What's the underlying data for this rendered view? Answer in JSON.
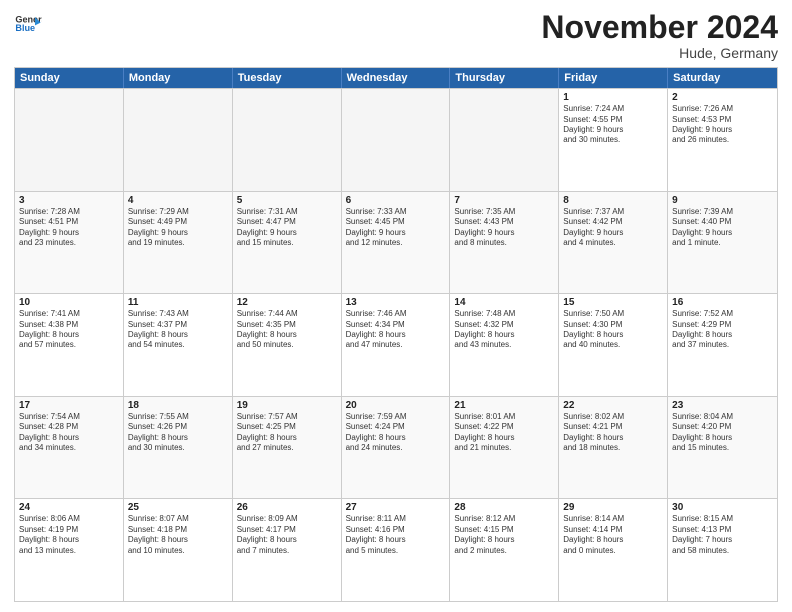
{
  "logo": {
    "general": "General",
    "blue": "Blue"
  },
  "header": {
    "month": "November 2024",
    "location": "Hude, Germany"
  },
  "weekdays": [
    "Sunday",
    "Monday",
    "Tuesday",
    "Wednesday",
    "Thursday",
    "Friday",
    "Saturday"
  ],
  "rows": [
    [
      {
        "day": "",
        "info": "",
        "empty": true
      },
      {
        "day": "",
        "info": "",
        "empty": true
      },
      {
        "day": "",
        "info": "",
        "empty": true
      },
      {
        "day": "",
        "info": "",
        "empty": true
      },
      {
        "day": "",
        "info": "",
        "empty": true
      },
      {
        "day": "1",
        "info": "Sunrise: 7:24 AM\nSunset: 4:55 PM\nDaylight: 9 hours\nand 30 minutes.",
        "empty": false
      },
      {
        "day": "2",
        "info": "Sunrise: 7:26 AM\nSunset: 4:53 PM\nDaylight: 9 hours\nand 26 minutes.",
        "empty": false
      }
    ],
    [
      {
        "day": "3",
        "info": "Sunrise: 7:28 AM\nSunset: 4:51 PM\nDaylight: 9 hours\nand 23 minutes.",
        "empty": false
      },
      {
        "day": "4",
        "info": "Sunrise: 7:29 AM\nSunset: 4:49 PM\nDaylight: 9 hours\nand 19 minutes.",
        "empty": false
      },
      {
        "day": "5",
        "info": "Sunrise: 7:31 AM\nSunset: 4:47 PM\nDaylight: 9 hours\nand 15 minutes.",
        "empty": false
      },
      {
        "day": "6",
        "info": "Sunrise: 7:33 AM\nSunset: 4:45 PM\nDaylight: 9 hours\nand 12 minutes.",
        "empty": false
      },
      {
        "day": "7",
        "info": "Sunrise: 7:35 AM\nSunset: 4:43 PM\nDaylight: 9 hours\nand 8 minutes.",
        "empty": false
      },
      {
        "day": "8",
        "info": "Sunrise: 7:37 AM\nSunset: 4:42 PM\nDaylight: 9 hours\nand 4 minutes.",
        "empty": false
      },
      {
        "day": "9",
        "info": "Sunrise: 7:39 AM\nSunset: 4:40 PM\nDaylight: 9 hours\nand 1 minute.",
        "empty": false
      }
    ],
    [
      {
        "day": "10",
        "info": "Sunrise: 7:41 AM\nSunset: 4:38 PM\nDaylight: 8 hours\nand 57 minutes.",
        "empty": false
      },
      {
        "day": "11",
        "info": "Sunrise: 7:43 AM\nSunset: 4:37 PM\nDaylight: 8 hours\nand 54 minutes.",
        "empty": false
      },
      {
        "day": "12",
        "info": "Sunrise: 7:44 AM\nSunset: 4:35 PM\nDaylight: 8 hours\nand 50 minutes.",
        "empty": false
      },
      {
        "day": "13",
        "info": "Sunrise: 7:46 AM\nSunset: 4:34 PM\nDaylight: 8 hours\nand 47 minutes.",
        "empty": false
      },
      {
        "day": "14",
        "info": "Sunrise: 7:48 AM\nSunset: 4:32 PM\nDaylight: 8 hours\nand 43 minutes.",
        "empty": false
      },
      {
        "day": "15",
        "info": "Sunrise: 7:50 AM\nSunset: 4:30 PM\nDaylight: 8 hours\nand 40 minutes.",
        "empty": false
      },
      {
        "day": "16",
        "info": "Sunrise: 7:52 AM\nSunset: 4:29 PM\nDaylight: 8 hours\nand 37 minutes.",
        "empty": false
      }
    ],
    [
      {
        "day": "17",
        "info": "Sunrise: 7:54 AM\nSunset: 4:28 PM\nDaylight: 8 hours\nand 34 minutes.",
        "empty": false
      },
      {
        "day": "18",
        "info": "Sunrise: 7:55 AM\nSunset: 4:26 PM\nDaylight: 8 hours\nand 30 minutes.",
        "empty": false
      },
      {
        "day": "19",
        "info": "Sunrise: 7:57 AM\nSunset: 4:25 PM\nDaylight: 8 hours\nand 27 minutes.",
        "empty": false
      },
      {
        "day": "20",
        "info": "Sunrise: 7:59 AM\nSunset: 4:24 PM\nDaylight: 8 hours\nand 24 minutes.",
        "empty": false
      },
      {
        "day": "21",
        "info": "Sunrise: 8:01 AM\nSunset: 4:22 PM\nDaylight: 8 hours\nand 21 minutes.",
        "empty": false
      },
      {
        "day": "22",
        "info": "Sunrise: 8:02 AM\nSunset: 4:21 PM\nDaylight: 8 hours\nand 18 minutes.",
        "empty": false
      },
      {
        "day": "23",
        "info": "Sunrise: 8:04 AM\nSunset: 4:20 PM\nDaylight: 8 hours\nand 15 minutes.",
        "empty": false
      }
    ],
    [
      {
        "day": "24",
        "info": "Sunrise: 8:06 AM\nSunset: 4:19 PM\nDaylight: 8 hours\nand 13 minutes.",
        "empty": false
      },
      {
        "day": "25",
        "info": "Sunrise: 8:07 AM\nSunset: 4:18 PM\nDaylight: 8 hours\nand 10 minutes.",
        "empty": false
      },
      {
        "day": "26",
        "info": "Sunrise: 8:09 AM\nSunset: 4:17 PM\nDaylight: 8 hours\nand 7 minutes.",
        "empty": false
      },
      {
        "day": "27",
        "info": "Sunrise: 8:11 AM\nSunset: 4:16 PM\nDaylight: 8 hours\nand 5 minutes.",
        "empty": false
      },
      {
        "day": "28",
        "info": "Sunrise: 8:12 AM\nSunset: 4:15 PM\nDaylight: 8 hours\nand 2 minutes.",
        "empty": false
      },
      {
        "day": "29",
        "info": "Sunrise: 8:14 AM\nSunset: 4:14 PM\nDaylight: 8 hours\nand 0 minutes.",
        "empty": false
      },
      {
        "day": "30",
        "info": "Sunrise: 8:15 AM\nSunset: 4:13 PM\nDaylight: 7 hours\nand 58 minutes.",
        "empty": false
      }
    ]
  ]
}
